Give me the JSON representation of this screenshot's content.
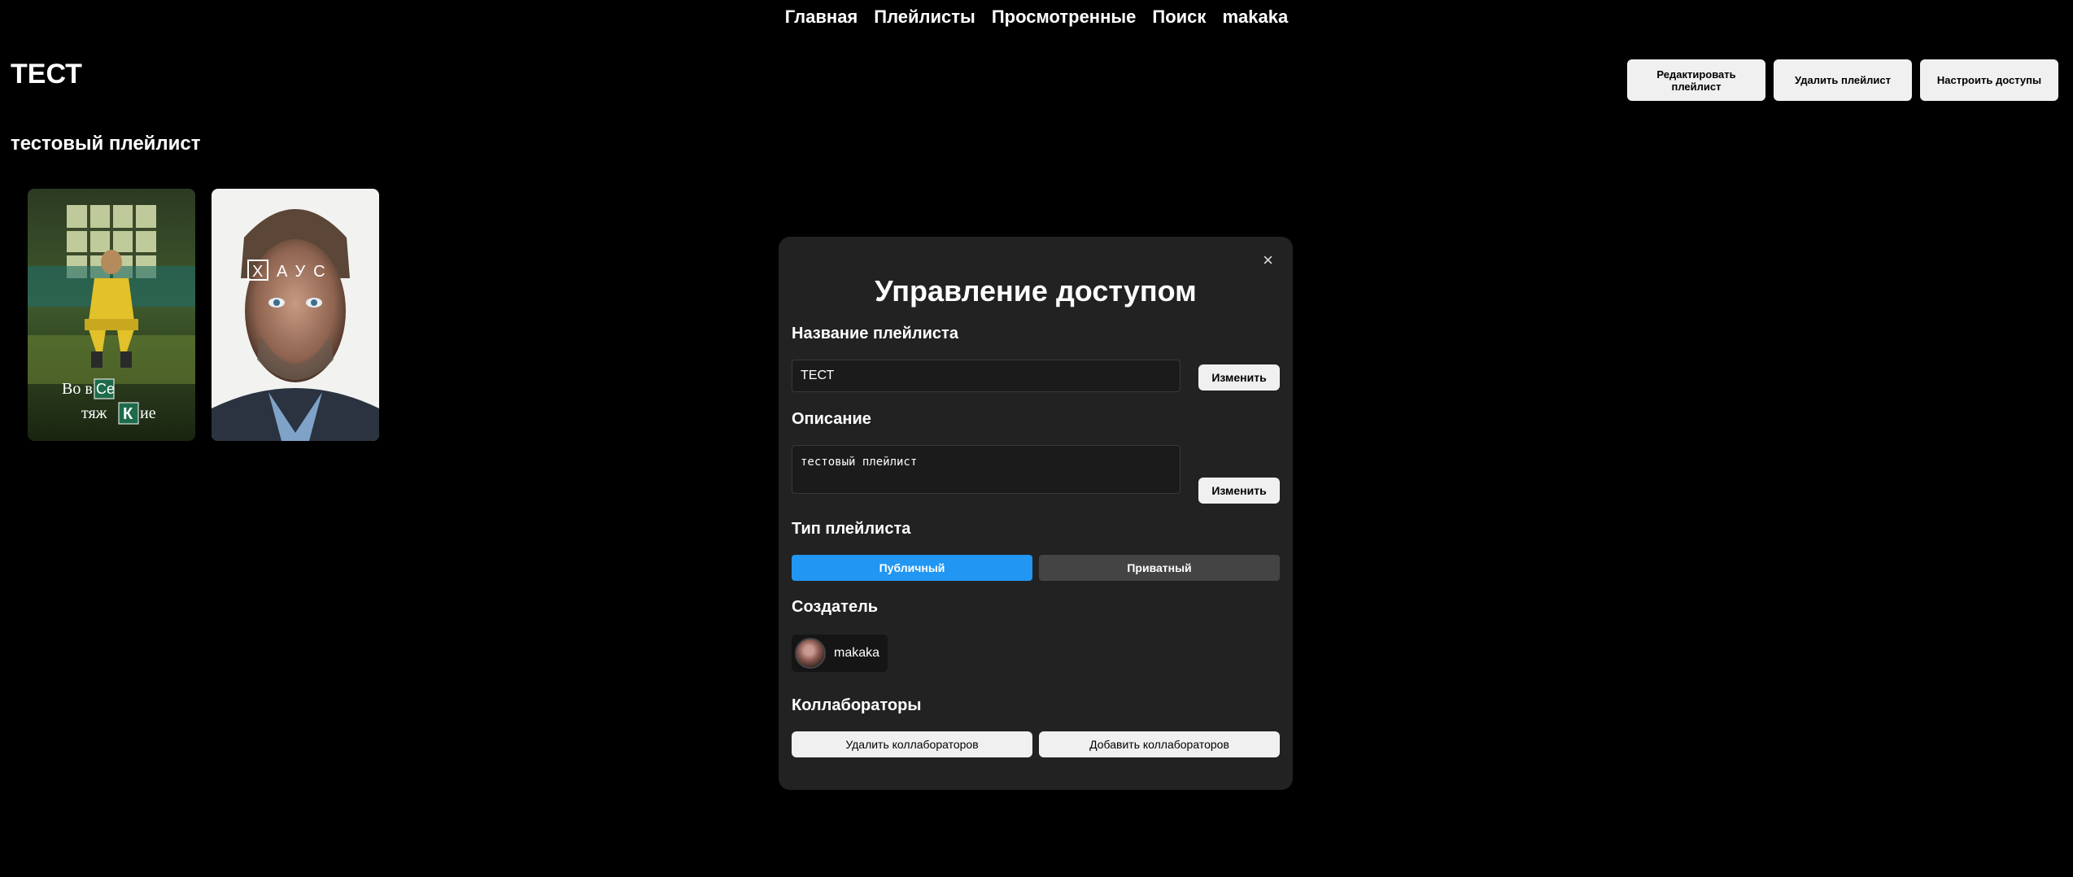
{
  "nav": {
    "items": [
      "Главная",
      "Плейлисты",
      "Просмотренные",
      "Поиск",
      "makaka"
    ]
  },
  "playlist": {
    "title": "ТЕСТ",
    "description": "тестовый плейлист",
    "actions": {
      "edit": "Редактировать плейлист",
      "delete": "Удалить плейлист",
      "access": "Настроить доступы"
    },
    "posters": [
      {
        "title_line1": "Во вСе",
        "title_line2": "тяжКие",
        "icon": "poster-breaking-bad"
      },
      {
        "title": "ХАУС",
        "icon": "poster-house"
      }
    ]
  },
  "modal": {
    "close": "×",
    "title": "Управление доступом",
    "name_label": "Название плейлиста",
    "name_value": "ТЕСТ",
    "change_label": "Изменить",
    "description_label": "Описание",
    "description_value": "тестовый плейлист",
    "type_label": "Тип плейлиста",
    "type_public": "Публичный",
    "type_private": "Приватный",
    "creator_label": "Создатель",
    "creator_name": "makaka",
    "collaborators_label": "Коллабораторы",
    "remove_collaborators": "Удалить коллабораторов",
    "add_collaborators": "Добавить коллабораторов"
  },
  "colors": {
    "background": "#000000",
    "modal_bg": "#222222",
    "active_type": "#2196f3",
    "inactive_type": "#444444",
    "light_button": "#f0f0f0"
  }
}
